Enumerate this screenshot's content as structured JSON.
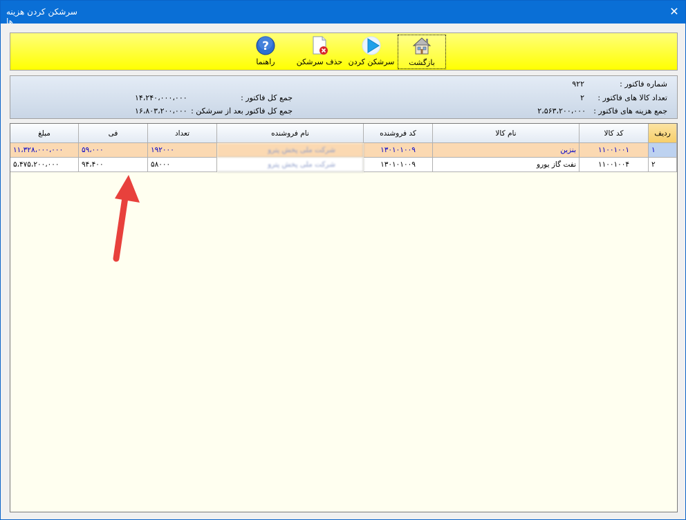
{
  "window": {
    "title": "سرشکن کردن هزینه ها",
    "close_glyph": "✕"
  },
  "toolbar": {
    "back_label": "بازگشت",
    "apportion_label": "سرشکن کردن",
    "delete_label": "حذف سرشکن",
    "help_label": "راهنما"
  },
  "info": {
    "invoice_no_label": "شماره فاکتور :",
    "invoice_no_value": "۹۲۲",
    "item_count_label": "تعداد کالا های فاکتور :",
    "item_count_value": "۲",
    "costs_total_label": "جمع هزینه های فاکتور :",
    "costs_total_value": "۲،۵۶۳،۲۰۰،۰۰۰",
    "invoice_total_label": "جمع کل فاکتور :",
    "invoice_total_value": "۱۴،۲۴۰،۰۰۰،۰۰۰",
    "after_total_label": "جمع کل فاکتور بعد از سرشکن :",
    "after_total_value": "۱۶،۸۰۳،۲۰۰،۰۰۰"
  },
  "grid": {
    "headers": {
      "row": "ردیف",
      "item_code": "کد کالا",
      "item_name": "نام کالا",
      "seller_code": "کد فروشنده",
      "seller_name": "نام فروشنده",
      "qty": "تعداد",
      "price": "فی",
      "amount": "مبلغ"
    },
    "rows": [
      {
        "row": "۱",
        "item_code": "۱۱۰۰۱۰۰۱",
        "item_name": "بنزین",
        "seller_code": "۱۳۰۱۰۱۰۰۹",
        "seller_name": "شرکت ملی پخش پترو",
        "qty": "۱۹۲۰۰۰",
        "price": "۵۹،۰۰۰",
        "amount": "۱۱،۳۲۸،۰۰۰،۰۰۰"
      },
      {
        "row": "۲",
        "item_code": "۱۱۰۰۱۰۰۴",
        "item_name": "نفت گاز یورو",
        "seller_code": "۱۳۰۱۰۱۰۰۹",
        "seller_name": "شرکت ملی پخش پترو",
        "qty": "۵۸۰۰۰",
        "price": "۹۴،۴۰۰",
        "amount": "۵،۴۷۵،۲۰۰،۰۰۰"
      }
    ]
  },
  "colors": {
    "titlebar": "#0a6fd6",
    "toolbar_yellow": "#ffff00",
    "selected_row": "#fbd9b2",
    "selected_text": "#0000c8",
    "arrow": "#e8413c"
  }
}
